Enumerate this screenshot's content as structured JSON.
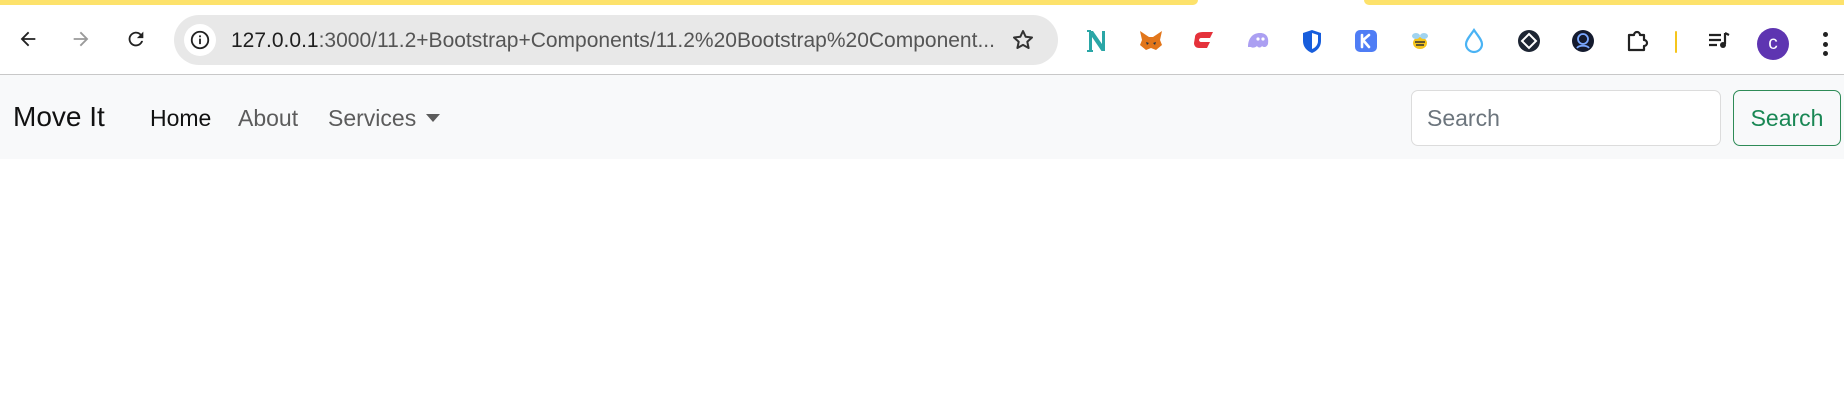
{
  "browser": {
    "url_host": "127.0.0.1",
    "url_rest": ":3000/11.2+Bootstrap+Components/11.2%20Bootstrap%20Component...",
    "avatar_letter": "c",
    "extensions": [
      "notion-icon",
      "metamask-icon",
      "red-wallet-icon",
      "phantom-icon",
      "bitwarden-shield-icon",
      "k-extension-icon",
      "bee-icon",
      "raindrop-icon",
      "crosshair-icon",
      "crypto-avatar-icon"
    ]
  },
  "navbar": {
    "brand": "Move It",
    "links": {
      "home": "Home",
      "about": "About",
      "services": "Services"
    },
    "search_placeholder": "Search",
    "search_button": "Search"
  },
  "colors": {
    "accent_yellow": "#fde26b",
    "navbar_bg": "#f8f9fa",
    "success_green": "#198754",
    "avatar_purple": "#5e35b1"
  }
}
